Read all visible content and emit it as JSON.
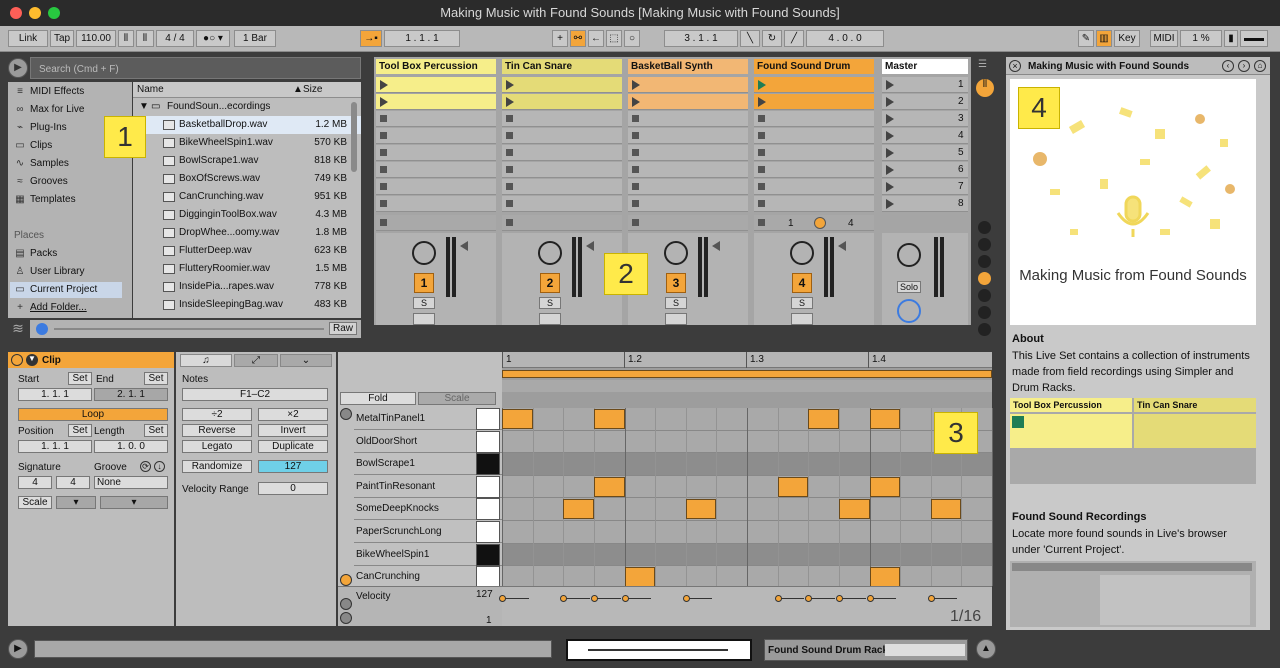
{
  "window": {
    "title": "Making Music with Found Sounds  [Making Music with Found Sounds]"
  },
  "toolbar": {
    "link": "Link",
    "tap": "Tap",
    "tempo": "110.00",
    "sig": "4 / 4",
    "quant": "1 Bar",
    "pos": "1 .  1 .  1",
    "loop_start": "3 .  1 .  1",
    "loop_len": "4 .  0 .  0",
    "key": "Key",
    "midi": "MIDI",
    "cpu": "1 %"
  },
  "browser": {
    "search_placeholder": "Search (Cmd + F)",
    "categories": [
      "MIDI Effects",
      "Max for Live",
      "Plug-Ins",
      "Clips",
      "Samples",
      "Grooves",
      "Templates"
    ],
    "places_header": "Places",
    "places": [
      "Packs",
      "User Library",
      "Current Project",
      "Add Folder..."
    ],
    "col_name": "Name",
    "col_size": "Size",
    "folder": "FoundSoun...ecordings",
    "files": [
      {
        "name": "BasketballDrop.wav",
        "size": "1.2 MB"
      },
      {
        "name": "BikeWheelSpin1.wav",
        "size": "570 KB"
      },
      {
        "name": "BowlScrape1.wav",
        "size": "818 KB"
      },
      {
        "name": "BoxOfScrews.wav",
        "size": "749 KB"
      },
      {
        "name": "CanCrunching.wav",
        "size": "951 KB"
      },
      {
        "name": "DigginginToolBox.wav",
        "size": "4.3 MB"
      },
      {
        "name": "DropWhee...oomy.wav",
        "size": "1.8 MB"
      },
      {
        "name": "FlutterDeep.wav",
        "size": "623 KB"
      },
      {
        "name": "FlutteryRoomier.wav",
        "size": "1.5 MB"
      },
      {
        "name": "InsidePia...rapes.wav",
        "size": "778 KB"
      },
      {
        "name": "InsideSleepingBag.wav",
        "size": "483 KB"
      }
    ],
    "raw": "Raw"
  },
  "callouts": [
    "1",
    "2",
    "3",
    "4"
  ],
  "session": {
    "tracks": [
      {
        "name": "Tool Box Percussion",
        "num": "1",
        "color": "#f6ee8a"
      },
      {
        "name": "Tin Can Snare",
        "num": "2",
        "color": "#e4db77"
      },
      {
        "name": "BasketBall Synth",
        "num": "3",
        "color": "#f2b774"
      },
      {
        "name": "Found Sound Drum",
        "num": "4",
        "color": "#f3a53a"
      }
    ],
    "master": "Master",
    "scenes": [
      "1",
      "2",
      "3",
      "4",
      "5",
      "6",
      "7",
      "8"
    ],
    "solo": "Solo",
    "s": "S",
    "xfade_a": "1",
    "xfade_b": "4"
  },
  "clip": {
    "title": "Clip",
    "start": "Start",
    "end": "End",
    "set": "Set",
    "start_val": "1.   1.   1",
    "end_val": "2.   1.   1",
    "loop": "Loop",
    "position": "Position",
    "length": "Length",
    "pos_val": "1.   1.   1",
    "len_val": "1.   0.   0",
    "signature": "Signature",
    "groove": "Groove",
    "sig_num": "4",
    "sig_den": "4",
    "groove_val": "None",
    "scale": "Scale"
  },
  "notes": {
    "title": "Notes",
    "range": "F1–C2",
    "div2": "÷2",
    "x2": "×2",
    "reverse": "Reverse",
    "invert": "Invert",
    "legato": "Legato",
    "duplicate": "Duplicate",
    "randomize": "Randomize",
    "rand_val": "127",
    "vel_range": "Velocity Range",
    "vel_range_val": "0"
  },
  "drumrack": {
    "fold": "Fold",
    "scale": "Scale",
    "rows": [
      "MetalTinPanel1",
      "OldDoorShort",
      "BowlScrape1",
      "PaintTinResonant",
      "SomeDeepKnocks",
      "PaperScrunchLong",
      "BikeWheelSpin1",
      "CanCrunching"
    ],
    "velocity": "Velocity",
    "vel_max": "127",
    "vel_min": "1"
  },
  "grid": {
    "bars": [
      "1",
      "1.2",
      "1.3",
      "1.4"
    ],
    "grid_label": "1/16",
    "notes": [
      [
        0,
        0
      ],
      [
        3,
        0
      ],
      [
        10,
        0
      ],
      [
        12,
        0
      ],
      [
        3,
        3
      ],
      [
        9,
        3
      ],
      [
        12,
        3
      ],
      [
        2,
        4
      ],
      [
        6,
        4
      ],
      [
        11,
        4
      ],
      [
        14,
        4
      ],
      [
        4,
        7
      ],
      [
        12,
        7
      ]
    ]
  },
  "info": {
    "title": "Making Music with Found Sounds",
    "hero_caption": "Making Music from Found Sounds",
    "about_head": "About",
    "about_text": "This Live Set contains a collection of instruments made from field recordings using Simpler and Drum Racks.",
    "mini_tracks": [
      "Tool Box Percussion",
      "Tin Can Snare"
    ],
    "recordings_head": "Found Sound Recordings",
    "recordings_text": "Locate more found sounds in Live's browser under 'Current Project'."
  },
  "status": {
    "device": "Found Sound Drum Rack"
  }
}
